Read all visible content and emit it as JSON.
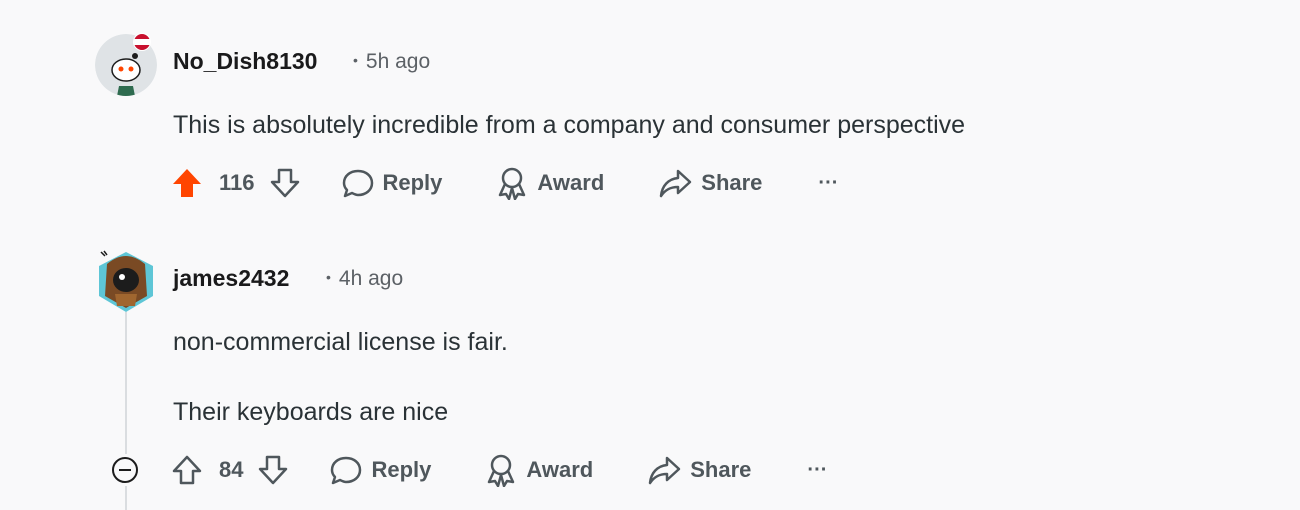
{
  "comments": [
    {
      "username": "No_Dish8130",
      "time": "5h ago",
      "paragraphs": [
        "This is absolutely incredible from a company and consumer perspective"
      ],
      "votes": "116",
      "upvoted": true,
      "reply_label": "Reply",
      "award_label": "Award",
      "share_label": "Share",
      "more_label": "···"
    },
    {
      "username": "james2432",
      "time": "4h ago",
      "paragraphs": [
        "non-commercial license is fair.",
        "Their keyboards are nice"
      ],
      "votes": "84",
      "upvoted": false,
      "reply_label": "Reply",
      "award_label": "Award",
      "share_label": "Share",
      "more_label": "···"
    }
  ],
  "colors": {
    "upvote_active": "#ff4500",
    "icon_gray": "#4f575c",
    "background": "#f9f9fa"
  }
}
